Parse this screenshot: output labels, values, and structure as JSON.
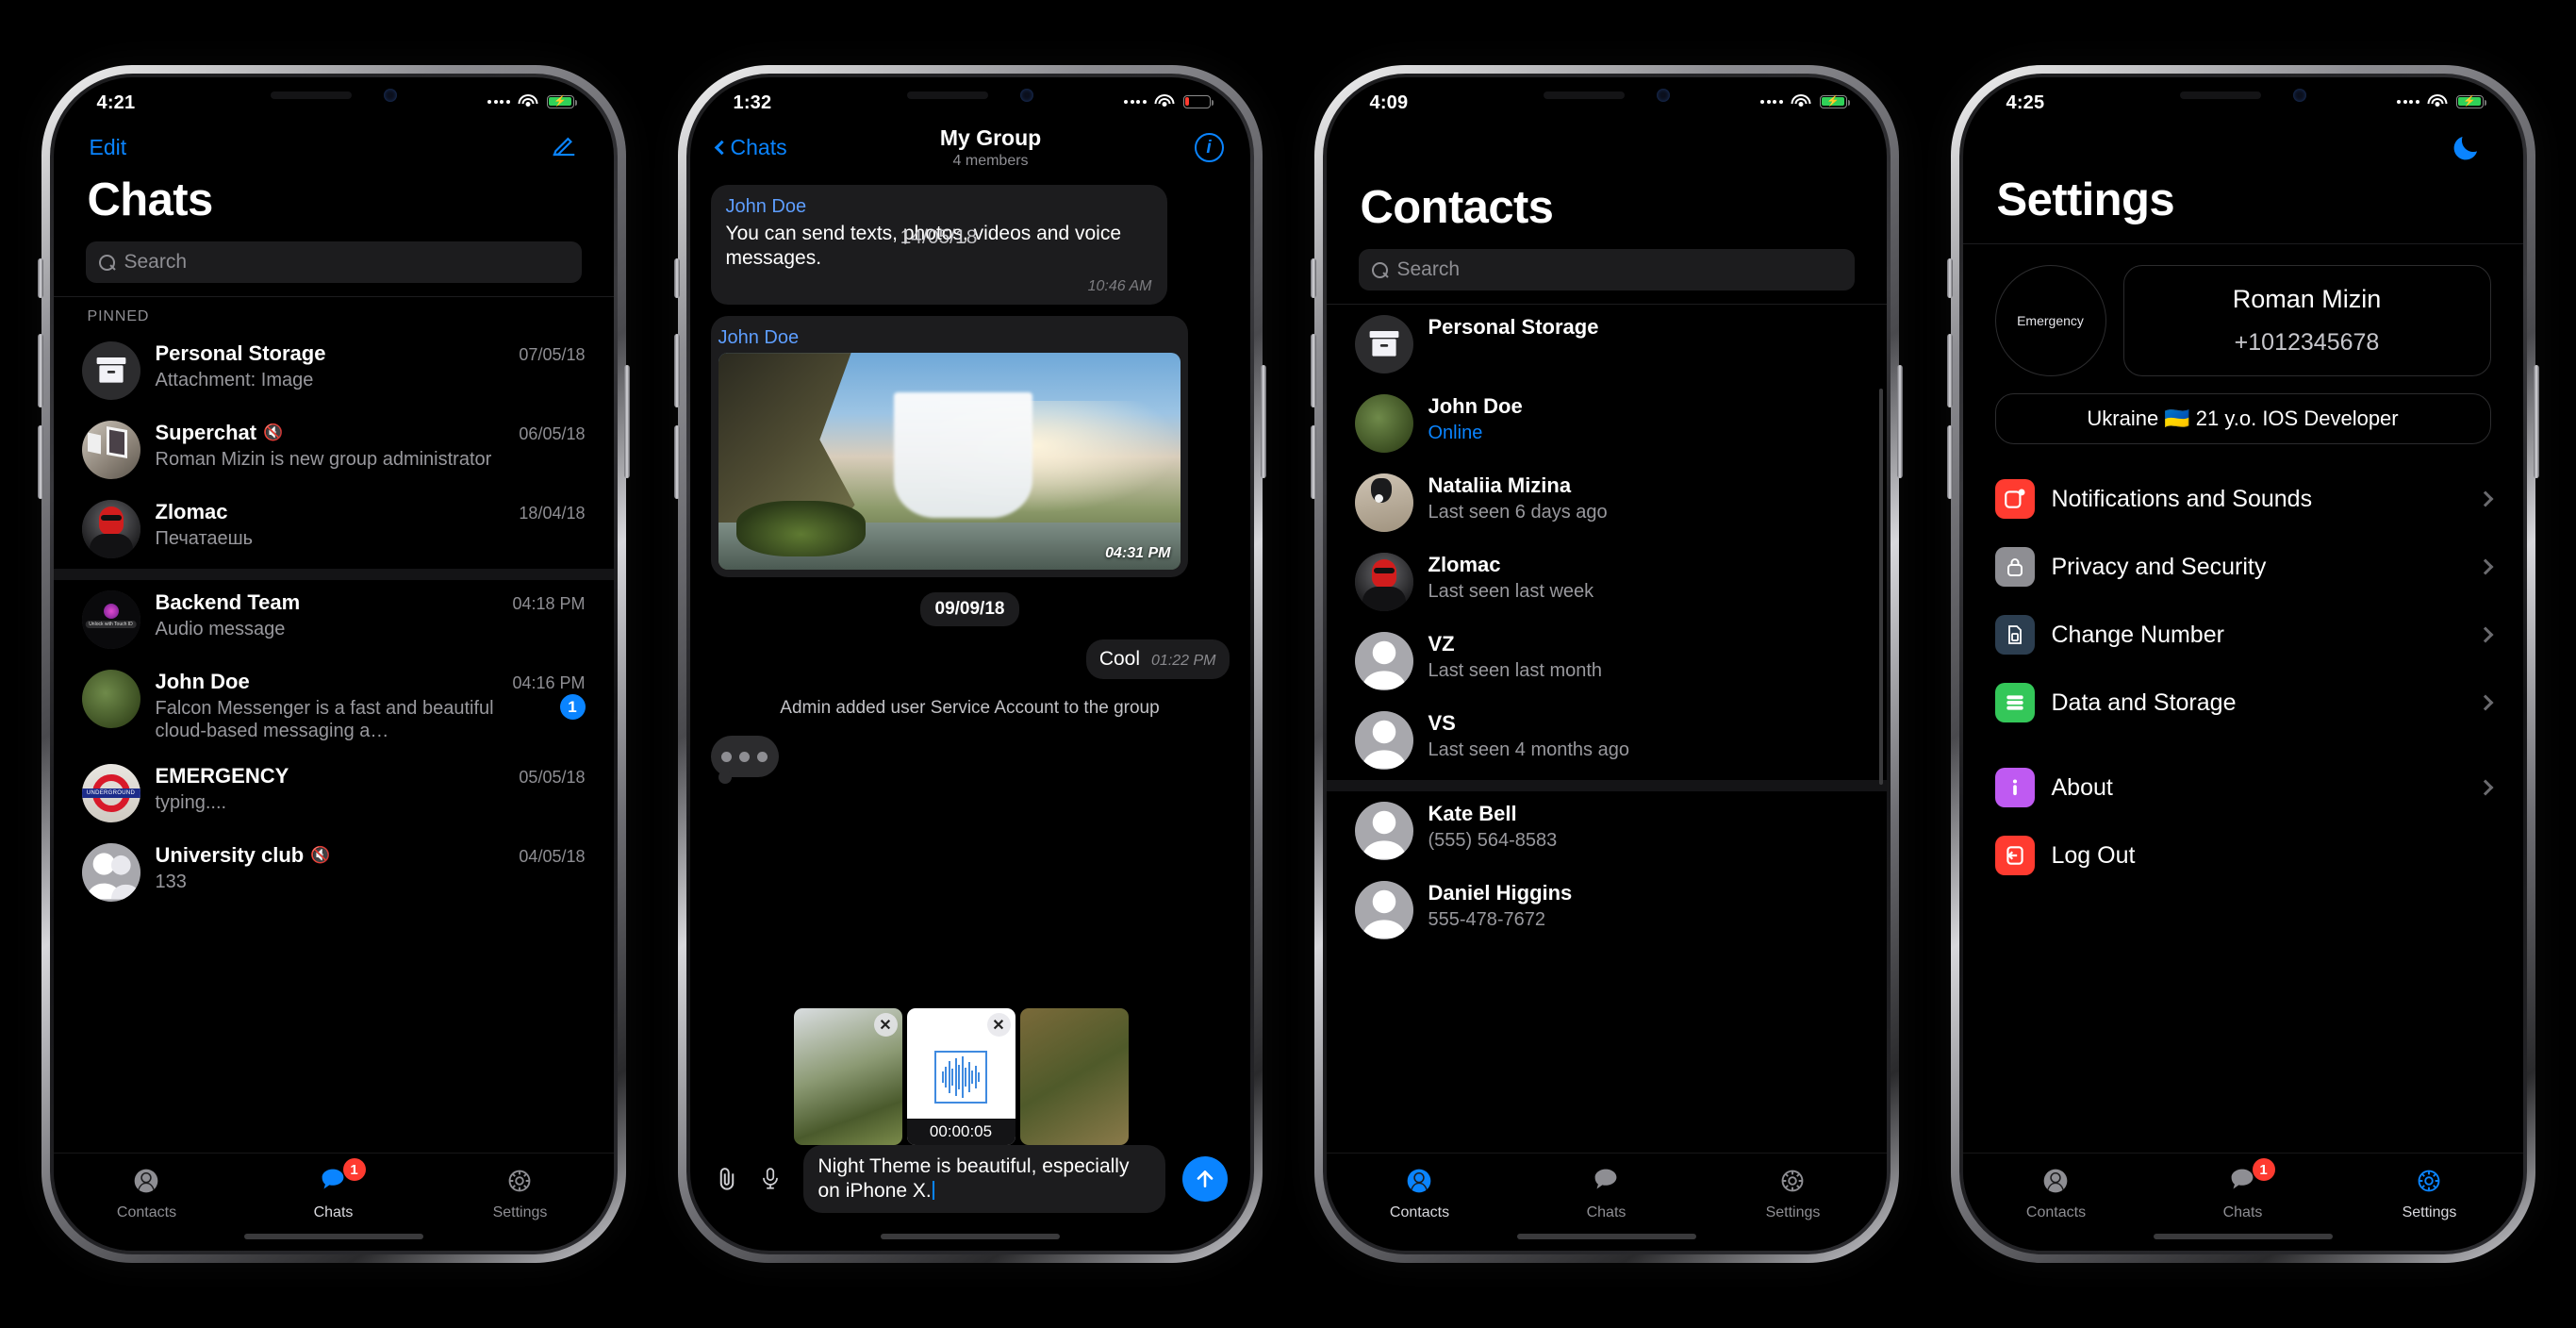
{
  "app": {
    "accent": "#0a84ff",
    "badge_red": "#ff3b30",
    "background": "#000000"
  },
  "phones": [
    {
      "id": "chats",
      "status": {
        "time": "4:21",
        "battery_pct": 100,
        "charging": true
      },
      "nav": {
        "left_label": "Edit",
        "right_icon": "compose-icon"
      },
      "title": "Chats",
      "search_placeholder": "Search",
      "section_pinned": "PINNED",
      "pinned": [
        {
          "name": "Personal Storage",
          "subtitle": "Attachment: Image",
          "time": "07/05/18",
          "muted": false,
          "avatar": "box",
          "badge": ""
        },
        {
          "name": "Superchat",
          "subtitle": "Roman Mizin is new group administrator",
          "time": "06/05/18",
          "muted": true,
          "avatar": "gallery",
          "badge": ""
        },
        {
          "name": "Zlomac",
          "subtitle": "Печатаешь",
          "time": "18/04/18",
          "muted": false,
          "avatar": "redmask",
          "badge": ""
        }
      ],
      "chats": [
        {
          "name": "Backend Team",
          "subtitle": "Audio message",
          "time": "04:18 PM",
          "muted": false,
          "avatar": "touchid",
          "badge": ""
        },
        {
          "name": "John Doe",
          "subtitle": "Falcon Messenger is a fast and beautiful cloud-based messaging a…",
          "time": "04:16 PM",
          "muted": false,
          "avatar": "grass",
          "badge": "1"
        },
        {
          "name": "EMERGENCY",
          "subtitle": "typing....",
          "time": "05/05/18",
          "muted": false,
          "avatar": "underground",
          "badge": ""
        },
        {
          "name": "University club",
          "subtitle": "133",
          "time": "04/05/18",
          "muted": true,
          "avatar": "group",
          "badge": ""
        }
      ],
      "tabs": [
        {
          "label": "Contacts",
          "icon": "contacts-icon",
          "active": false,
          "badge": ""
        },
        {
          "label": "Chats",
          "icon": "chats-icon",
          "active": true,
          "badge": "1"
        },
        {
          "label": "Settings",
          "icon": "settings-icon",
          "active": false,
          "badge": ""
        }
      ]
    },
    {
      "id": "conversation",
      "status": {
        "time": "1:32",
        "battery_pct": 12,
        "charging": false
      },
      "nav": {
        "back_label": "Chats",
        "info_icon": "info-icon"
      },
      "title": "My Group",
      "subtitle": "4 members",
      "messages": [
        {
          "type": "incoming",
          "sender": "John Doe",
          "text": "You can send texts, photos, videos and voice messages.",
          "time": "10:46 AM",
          "overlay_date": "14/05/18"
        },
        {
          "type": "incoming-photo",
          "sender": "John Doe",
          "time": "04:31 PM",
          "photo": "waterfall"
        }
      ],
      "date_separator": "09/09/18",
      "outgoing": {
        "text": "Cool",
        "time": "01:22 PM"
      },
      "system_message": "Admin added user Service Account to the group",
      "typing_indicator": true,
      "attachments": [
        {
          "kind": "image",
          "label": ""
        },
        {
          "kind": "audio",
          "label": "00:00:05"
        },
        {
          "kind": "image",
          "label": ""
        }
      ],
      "composer": {
        "attach_icon": "paperclip-icon",
        "mic_icon": "microphone-icon",
        "text": "Night Theme is beautiful, especially on iPhone X.",
        "send_icon": "send-up-arrow-icon"
      }
    },
    {
      "id": "contacts",
      "status": {
        "time": "4:09",
        "battery_pct": 100,
        "charging": true
      },
      "title": "Contacts",
      "search_placeholder": "Search",
      "users": [
        {
          "name": "Personal Storage",
          "subtitle": "",
          "subtitle_color": "#98989d",
          "avatar": "box"
        },
        {
          "name": "John Doe",
          "subtitle": "Online",
          "subtitle_color": "#0a84ff",
          "avatar": "grass"
        },
        {
          "name": "Nataliia Mizina",
          "subtitle": "Last seen 6 days ago",
          "subtitle_color": "#98989d",
          "avatar": "cat"
        },
        {
          "name": "Zlomac",
          "subtitle": "Last seen last week",
          "subtitle_color": "#98989d",
          "avatar": "redmask"
        },
        {
          "name": "VZ",
          "subtitle": "Last seen last month",
          "subtitle_color": "#98989d",
          "avatar": "person"
        },
        {
          "name": "VS",
          "subtitle": "Last seen 4 months ago",
          "subtitle_color": "#98989d",
          "avatar": "person"
        }
      ],
      "contacts": [
        {
          "name": "Kate Bell",
          "subtitle": "(555) 564-8583",
          "subtitle_color": "#98989d",
          "avatar": "person"
        },
        {
          "name": "Daniel Higgins",
          "subtitle": "555-478-7672",
          "subtitle_color": "#98989d",
          "avatar": "person"
        }
      ],
      "tabs": [
        {
          "label": "Contacts",
          "icon": "contacts-icon",
          "active": true,
          "badge": ""
        },
        {
          "label": "Chats",
          "icon": "chats-icon",
          "active": false,
          "badge": ""
        },
        {
          "label": "Settings",
          "icon": "settings-icon",
          "active": false,
          "badge": ""
        }
      ]
    },
    {
      "id": "settings",
      "status": {
        "time": "4:25",
        "battery_pct": 100,
        "charging": true
      },
      "title": "Settings",
      "night_icon": "moon-icon",
      "emergency_label": "Emergency",
      "profile": {
        "name": "Roman Mizin",
        "phone": "+1012345678"
      },
      "bio": "Ukraine 🇺🇦 21 y.o. IOS Developer",
      "items": [
        {
          "label": "Notifications and Sounds",
          "icon": "notifications-icon",
          "color": "#ff3b30",
          "chevron": true
        },
        {
          "label": "Privacy and Security",
          "icon": "lock-icon",
          "color": "#8e8e93",
          "chevron": true
        },
        {
          "label": "Change Number",
          "icon": "sim-card-icon",
          "color": "#2c3e50",
          "chevron": true
        },
        {
          "label": "Data and Storage",
          "icon": "database-icon",
          "color": "#34c759",
          "chevron": true
        }
      ],
      "items2": [
        {
          "label": "About",
          "icon": "info-circle-icon",
          "color": "#bf5af2",
          "chevron": true
        },
        {
          "label": "Log Out",
          "icon": "logout-icon",
          "color": "#ff3b30",
          "chevron": false
        }
      ],
      "tabs": [
        {
          "label": "Contacts",
          "icon": "contacts-icon",
          "active": false,
          "badge": ""
        },
        {
          "label": "Chats",
          "icon": "chats-icon",
          "active": false,
          "badge": "1"
        },
        {
          "label": "Settings",
          "icon": "settings-icon",
          "active": true,
          "badge": ""
        }
      ]
    }
  ]
}
